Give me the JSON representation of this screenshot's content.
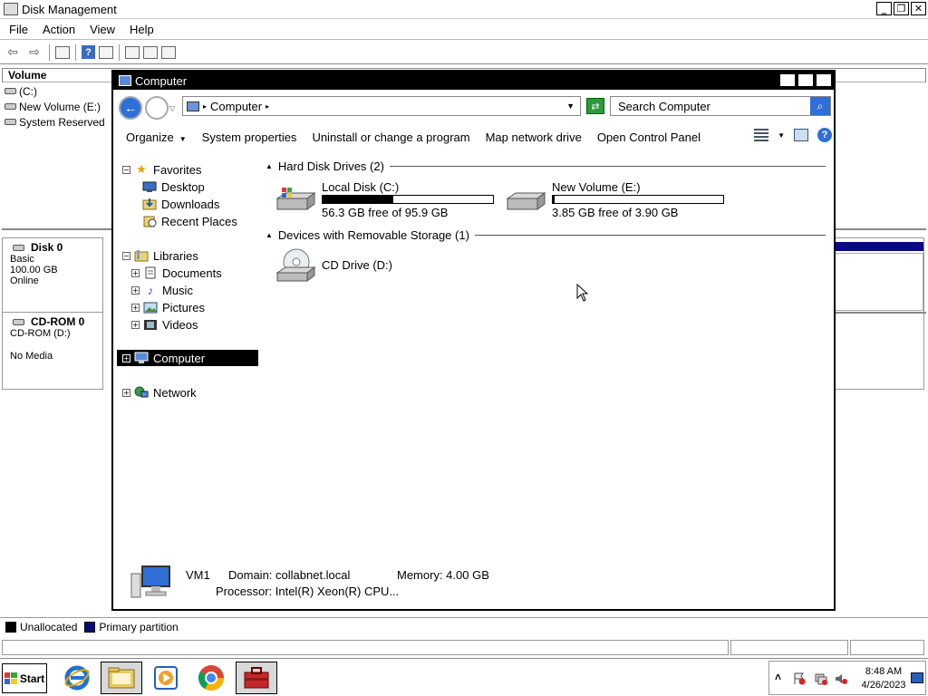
{
  "disk_management": {
    "title": "Disk Management",
    "menu": [
      "File",
      "Action",
      "View",
      "Help"
    ],
    "volume_header": "Volume",
    "volumes": [
      "(C:)",
      "New Volume (E:)",
      "System Reserved"
    ],
    "disks": [
      {
        "name": "Disk 0",
        "type": "Basic",
        "size": "100.00 GB",
        "status": "Online"
      },
      {
        "name": "CD-ROM 0",
        "type": "CD-ROM (D:)",
        "size": "",
        "status": "No Media"
      }
    ],
    "legend": [
      {
        "label": "Unallocated",
        "color": "#000000"
      },
      {
        "label": "Primary partition",
        "color": "#0a0a80"
      }
    ]
  },
  "explorer": {
    "title": "Computer",
    "address": "Computer",
    "search_placeholder": "Search Computer",
    "commands": {
      "organize": "Organize",
      "system_properties": "System properties",
      "uninstall": "Uninstall or change a program",
      "map_drive": "Map network drive",
      "control_panel": "Open Control Panel"
    },
    "nav": {
      "favorites": "Favorites",
      "desktop": "Desktop",
      "downloads": "Downloads",
      "recent_places": "Recent Places",
      "libraries": "Libraries",
      "documents": "Documents",
      "music": "Music",
      "pictures": "Pictures",
      "videos": "Videos",
      "computer": "Computer",
      "network": "Network"
    },
    "groups": {
      "hard_disks": "Hard Disk Drives (2)",
      "removable": "Devices with Removable Storage (1)"
    },
    "drives": [
      {
        "name": "Local Disk (C:)",
        "free_text": "56.3 GB free of 95.9 GB",
        "used_fraction": 0.413
      },
      {
        "name": "New Volume (E:)",
        "free_text": "3.85 GB free of 3.90 GB",
        "used_fraction": 0.013
      }
    ],
    "removable": [
      {
        "name": "CD Drive (D:)"
      }
    ],
    "details": {
      "computer_name": "VM1",
      "domain": "Domain: collabnet.local",
      "memory": "Memory: 4.00 GB",
      "processor": "Processor: Intel(R) Xeon(R) CPU..."
    }
  },
  "taskbar": {
    "start": "Start",
    "time": "8:48 AM",
    "date": "4/26/2023"
  },
  "colors": {
    "selection": "#000000",
    "primary_partition": "#0a0a80",
    "accent_blue": "#2f6fd6"
  }
}
